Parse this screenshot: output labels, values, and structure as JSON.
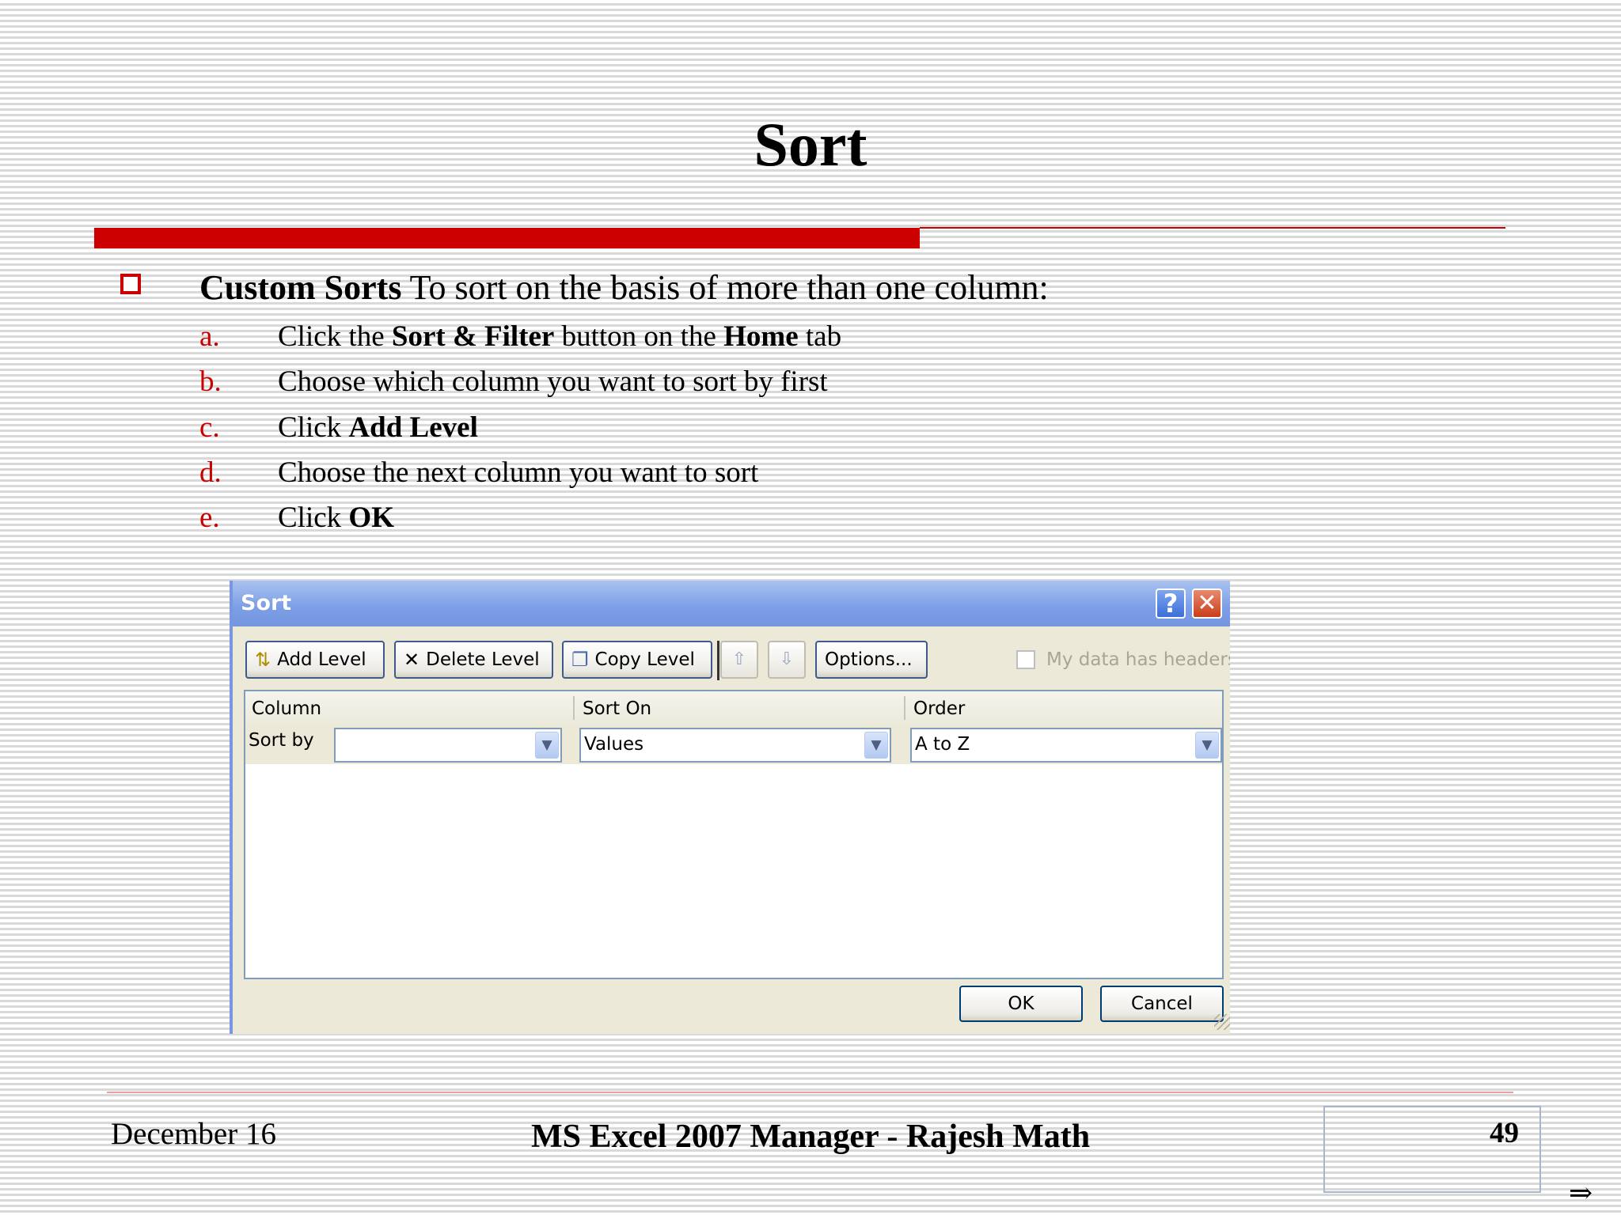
{
  "slide": {
    "title": "Sort",
    "bullet": {
      "heading": "Custom Sorts",
      "text": " To sort on the basis of more than one column:"
    },
    "steps": [
      {
        "letter": "a.",
        "parts": [
          "Click the ",
          "Sort & Filter",
          " button on the ",
          "Home",
          " tab"
        ]
      },
      {
        "letter": "b.",
        "parts": [
          "Choose which column you want to sort by first"
        ]
      },
      {
        "letter": "c.",
        "parts": [
          "Click ",
          "Add Level"
        ]
      },
      {
        "letter": "d.",
        "parts": [
          "Choose the next column you want to sort"
        ]
      },
      {
        "letter": "e.",
        "parts": [
          "Click ",
          "OK"
        ]
      }
    ]
  },
  "dialog": {
    "title": "Sort",
    "help_glyph": "?",
    "close_glyph": "✕",
    "toolbar": {
      "add_level": "Add Level",
      "delete_level": "Delete Level",
      "copy_level": "Copy Level",
      "move_up_glyph": "⇧",
      "move_down_glyph": "⇩",
      "options": "Options..."
    },
    "headers_checkbox_label": "My data has headers",
    "columns": {
      "column": "Column",
      "sort_on": "Sort On",
      "order": "Order"
    },
    "row": {
      "label": "Sort by",
      "column_value": "",
      "sort_on_value": "Values",
      "order_value": "A to Z"
    },
    "ok": "OK",
    "cancel": "Cancel"
  },
  "footer": {
    "date": "December 16",
    "center": "MS Excel 2007 Manager - Rajesh Math",
    "page": "49",
    "next_glyph": "⇒"
  },
  "colors": {
    "accent_red": "#cc0000",
    "titlebar_blue": "#7b9ee6",
    "dialog_bg": "#ece9d8"
  },
  "icons": [
    "checkbox-outline-icon",
    "help-icon",
    "close-icon",
    "add-level-icon",
    "delete-level-icon",
    "copy-level-icon",
    "arrow-up-icon",
    "arrow-down-icon",
    "chevron-down-icon",
    "resize-grip-icon",
    "next-arrow-icon"
  ]
}
